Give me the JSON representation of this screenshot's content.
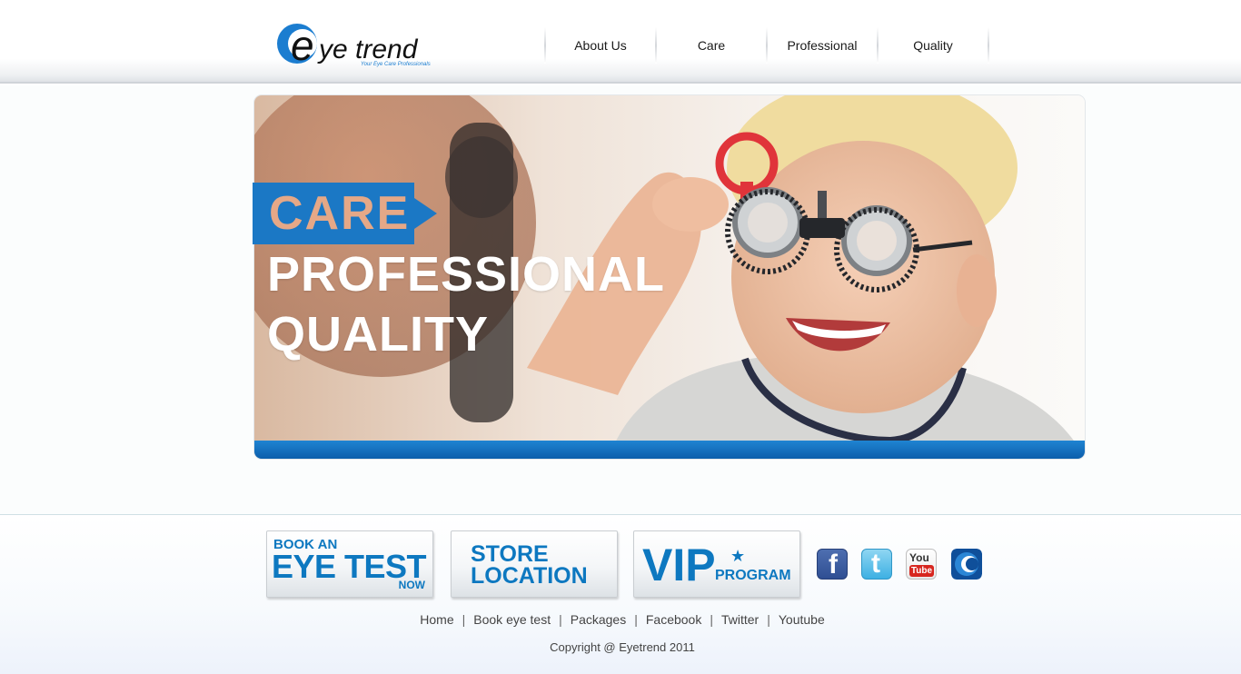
{
  "header": {
    "logo_word": "eye trend",
    "logo_tagline": "Your Eye Care Professionals",
    "nav": [
      "About Us",
      "Care",
      "Professional",
      "Quality"
    ]
  },
  "hero": {
    "line1": "CARE",
    "line2": "PROFESSIONAL",
    "line3": "QUALITY"
  },
  "promos": {
    "book": {
      "top": "BOOK AN",
      "main": "EYE TEST",
      "sub": "NOW"
    },
    "store": {
      "line1": "STORE",
      "line2": "LOCATION"
    },
    "vip": {
      "main": "VIP",
      "star": "★",
      "sub": "PROGRAM"
    }
  },
  "social": [
    "facebook-icon",
    "twitter-icon",
    "youtube-icon",
    "eyetrend-icon"
  ],
  "social_labels": {
    "facebook": "f",
    "twitter": "t",
    "youtube_top": "You",
    "youtube_bottom": "Tube"
  },
  "footer": {
    "links": [
      "Home",
      "Book eye test",
      "Packages",
      "Facebook",
      "Twitter",
      "Youtube"
    ],
    "separator": "|",
    "copyright": "Copyright @ Eyetrend 2011"
  },
  "colors": {
    "brand_blue": "#1b78c5",
    "care_peach": "#e5a887",
    "hero_bar": "#0c5eab"
  }
}
